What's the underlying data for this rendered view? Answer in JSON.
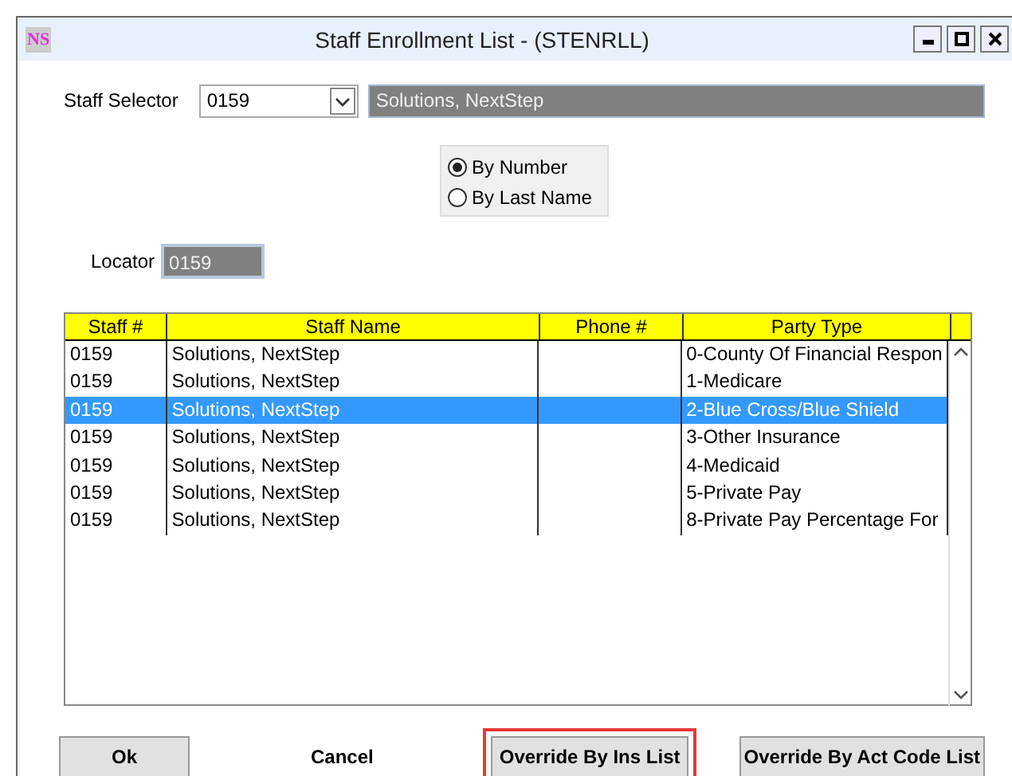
{
  "window": {
    "title": "Staff Enrollment List - (STENRLL)",
    "logo": "NS"
  },
  "staff_selector": {
    "label": "Staff Selector",
    "value": "0159",
    "name": "Solutions, NextStep"
  },
  "sort_options": [
    {
      "label": "By Number",
      "selected": true
    },
    {
      "label": "By Last Name",
      "selected": false
    }
  ],
  "locator": {
    "label": "Locator",
    "value": "0159"
  },
  "table": {
    "columns": [
      "Staff #",
      "Staff Name",
      "Phone #",
      "Party Type"
    ],
    "rows": [
      {
        "cells": [
          "0159",
          "Solutions, NextStep",
          "",
          "0-County Of Financial Respon"
        ],
        "selected": false
      },
      {
        "cells": [
          "0159",
          "Solutions, NextStep",
          "",
          "1-Medicare"
        ],
        "selected": false
      },
      {
        "cells": [
          "0159",
          "Solutions, NextStep",
          "",
          "2-Blue Cross/Blue Shield"
        ],
        "selected": true
      },
      {
        "cells": [
          "0159",
          "Solutions, NextStep",
          "",
          "3-Other Insurance"
        ],
        "selected": false
      },
      {
        "cells": [
          "0159",
          "Solutions, NextStep",
          "",
          "4-Medicaid"
        ],
        "selected": false
      },
      {
        "cells": [
          "0159",
          "Solutions, NextStep",
          "",
          "5-Private Pay"
        ],
        "selected": false
      },
      {
        "cells": [
          "0159",
          "Solutions, NextStep",
          "",
          "8-Private Pay Percentage For"
        ],
        "selected": false
      }
    ]
  },
  "buttons": [
    {
      "label": "Ok",
      "kind": "button",
      "highlighted": false
    },
    {
      "label": "Cancel",
      "kind": "flat",
      "highlighted": false
    },
    {
      "label": "Override By Ins List",
      "kind": "button",
      "highlighted": true
    },
    {
      "label": "Override By Act Code List",
      "kind": "button",
      "highlighted": false
    }
  ]
}
